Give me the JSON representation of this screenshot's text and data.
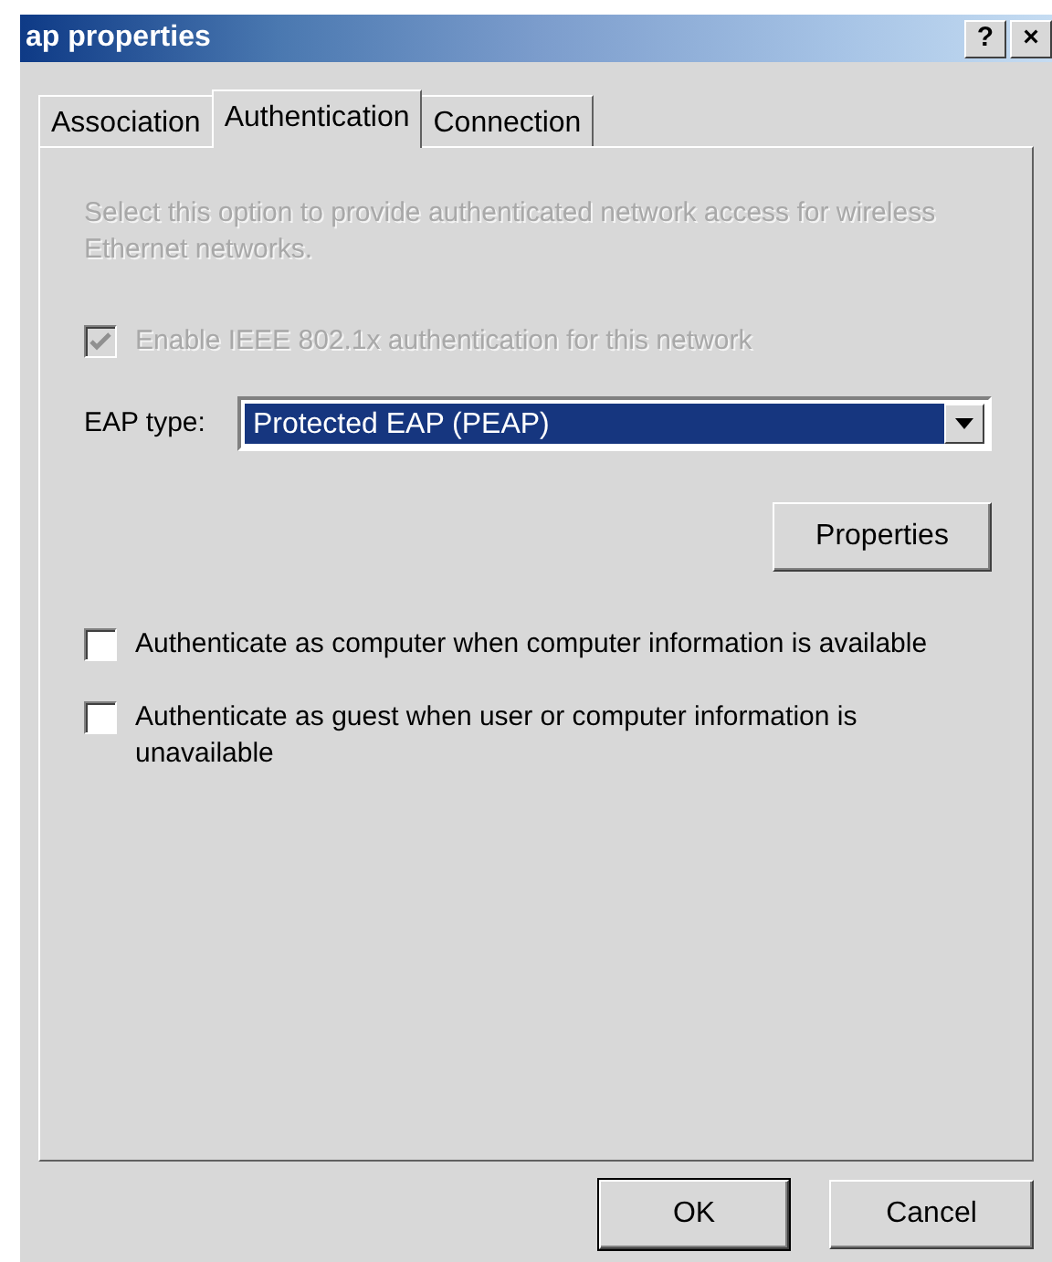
{
  "window": {
    "title": "ap properties",
    "controls": [
      "?",
      "×"
    ]
  },
  "tabs": [
    {
      "label": "Association",
      "selected": false
    },
    {
      "label": "Authentication",
      "selected": true
    },
    {
      "label": "Connection",
      "selected": false
    }
  ],
  "description": {
    "text": "Select this option to provide authenticated network access for wireless Ethernet networks.",
    "disabled": true
  },
  "enable_option": {
    "label": "Enable IEEE 802.1x authentication for this network",
    "checked": true,
    "disabled": true
  },
  "eap_type": {
    "label": "EAP type:",
    "value": "Protected EAP (PEAP)"
  },
  "properties_button": "Properties",
  "options": [
    {
      "label": "Authenticate as computer when computer information is available",
      "checked": false
    },
    {
      "label": "Authenticate as guest when user or computer information is unavailable",
      "checked": false
    }
  ],
  "buttons": [
    {
      "label": "OK",
      "default": true
    },
    {
      "label": "Cancel",
      "default": false
    }
  ]
}
